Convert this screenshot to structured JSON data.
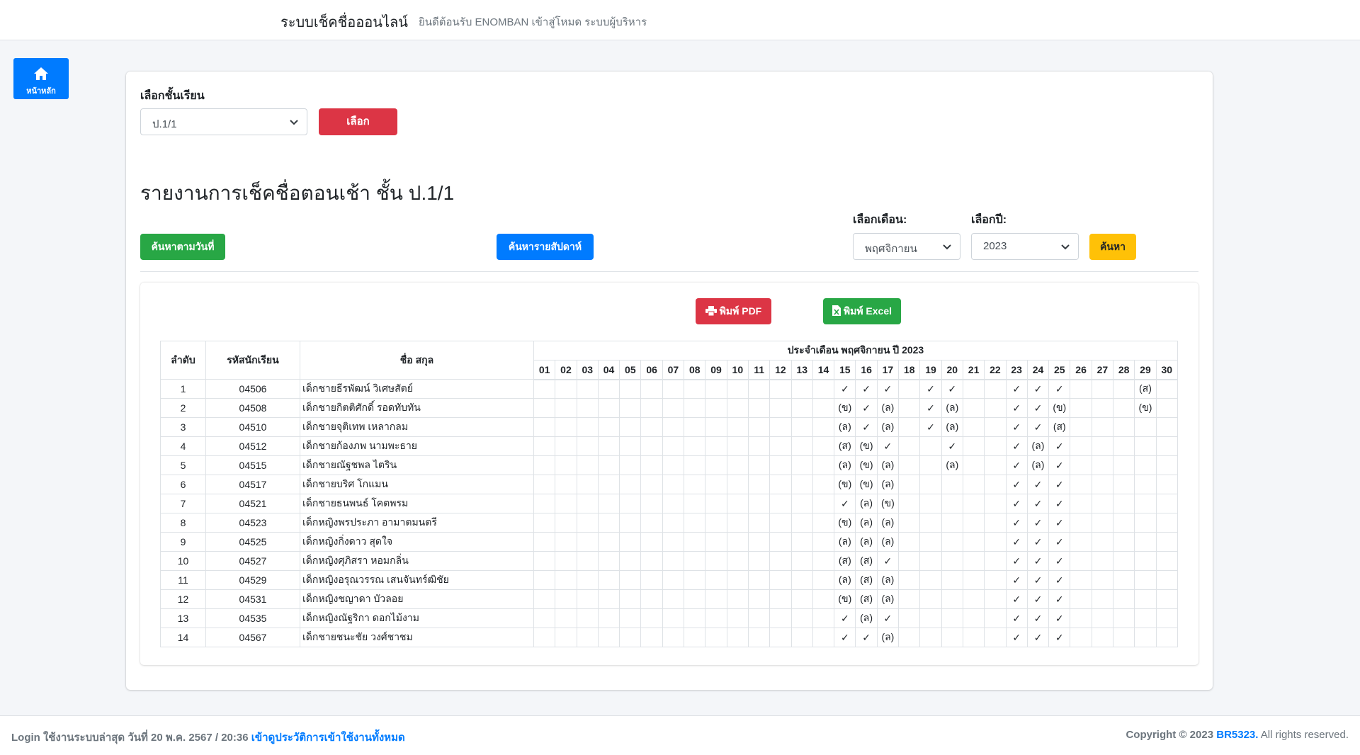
{
  "header": {
    "brand": "ระบบเช็คชื่อออนไลน์",
    "welcome": "ยินดีต้อนรับ ENOMBAN เข้าสู่โหมด ระบบผู้บริหาร"
  },
  "sidebar": {
    "home_label": "หน้าหลัก"
  },
  "class_select": {
    "label": "เลือกชั้นเรียน",
    "value": "ป.1/1",
    "button": "เลือก"
  },
  "report": {
    "title": "รายงานการเช็คชื่อตอนเช้า ชั้น ป.1/1",
    "search_by_date": "ค้นหาตามวันที่",
    "search_by_week": "ค้นหารายสัปดาห์",
    "month_label": "เลือกเดือน:",
    "month_value": "พฤศจิกายน",
    "year_label": "เลือกปี:",
    "year_value": "2023",
    "search_button": "ค้นหา",
    "print_pdf": "พิมพ์ PDF",
    "print_excel": "พิมพ์ Excel"
  },
  "table": {
    "col_no": "ลำดับ",
    "col_id": "รหัสนักเรียน",
    "col_name": "ชื่อ สกุล",
    "month_header": "ประจำเดือน พฤศจิกายน ปี 2023",
    "days": [
      "01",
      "02",
      "03",
      "04",
      "05",
      "06",
      "07",
      "08",
      "09",
      "10",
      "11",
      "12",
      "13",
      "14",
      "15",
      "16",
      "17",
      "18",
      "19",
      "20",
      "21",
      "22",
      "23",
      "24",
      "25",
      "26",
      "27",
      "28",
      "29",
      "30"
    ],
    "rows": [
      {
        "no": "1",
        "id": "04506",
        "name": "เด็กชายธีรพัฒน์ วิเศษสัตย์",
        "marks": {
          "15": "✓",
          "16": "✓",
          "17": "✓",
          "19": "✓",
          "20": "✓",
          "23": "✓",
          "24": "✓",
          "25": "✓",
          "29": "(ส)"
        }
      },
      {
        "no": "2",
        "id": "04508",
        "name": "เด็กชายกิตติศักดิ์ รอดทับทัน",
        "marks": {
          "15": "(ข)",
          "16": "✓",
          "17": "(ล)",
          "19": "✓",
          "20": "(ล)",
          "23": "✓",
          "24": "✓",
          "25": "(ข)",
          "29": "(ข)"
        }
      },
      {
        "no": "3",
        "id": "04510",
        "name": "เด็กชายจุติเทพ เหลากลม",
        "marks": {
          "15": "(ล)",
          "16": "✓",
          "17": "(ล)",
          "19": "✓",
          "20": "(ล)",
          "23": "✓",
          "24": "✓",
          "25": "(ส)"
        }
      },
      {
        "no": "4",
        "id": "04512",
        "name": "เด็กชายก้องภพ นามพะธาย",
        "marks": {
          "15": "(ส)",
          "16": "(ข)",
          "17": "✓",
          "20": "✓",
          "23": "✓",
          "24": "(ล)",
          "25": "✓"
        }
      },
      {
        "no": "5",
        "id": "04515",
        "name": "เด็กชายณัฐชพล ไตริน",
        "marks": {
          "15": "(ล)",
          "16": "(ข)",
          "17": "(ล)",
          "20": "(ล)",
          "23": "✓",
          "24": "(ล)",
          "25": "✓"
        }
      },
      {
        "no": "6",
        "id": "04517",
        "name": "เด็กชายบริศ โกแมน",
        "marks": {
          "15": "(ข)",
          "16": "(ข)",
          "17": "(ล)",
          "23": "✓",
          "24": "✓",
          "25": "✓"
        }
      },
      {
        "no": "7",
        "id": "04521",
        "name": "เด็กชายธนพนธ์ โคตพรม",
        "marks": {
          "15": "✓",
          "16": "(ล)",
          "17": "(ข)",
          "23": "✓",
          "24": "✓",
          "25": "✓"
        }
      },
      {
        "no": "8",
        "id": "04523",
        "name": "เด็กหญิงพรประภา อามาตมนตรี",
        "marks": {
          "15": "(ข)",
          "16": "(ล)",
          "17": "(ล)",
          "23": "✓",
          "24": "✓",
          "25": "✓"
        }
      },
      {
        "no": "9",
        "id": "04525",
        "name": "เด็กหญิงกิ่งดาว สุดใจ",
        "marks": {
          "15": "(ล)",
          "16": "(ล)",
          "17": "(ล)",
          "23": "✓",
          "24": "✓",
          "25": "✓"
        }
      },
      {
        "no": "10",
        "id": "04527",
        "name": "เด็กหญิงศุภิสรา หอมกลิ่น",
        "marks": {
          "15": "(ส)",
          "16": "(ส)",
          "17": "✓",
          "23": "✓",
          "24": "✓",
          "25": "✓"
        }
      },
      {
        "no": "11",
        "id": "04529",
        "name": "เด็กหญิงอรุณวรรณ เสนจันทร์ฒิชัย",
        "marks": {
          "15": "(ล)",
          "16": "(ส)",
          "17": "(ล)",
          "23": "✓",
          "24": "✓",
          "25": "✓"
        }
      },
      {
        "no": "12",
        "id": "04531",
        "name": "เด็กหญิงชญาดา บัวลอย",
        "marks": {
          "15": "(ข)",
          "16": "(ส)",
          "17": "(ล)",
          "23": "✓",
          "24": "✓",
          "25": "✓"
        }
      },
      {
        "no": "13",
        "id": "04535",
        "name": "เด็กหญิงณัฐริกา ดอกไม้งาม",
        "marks": {
          "15": "✓",
          "16": "(ล)",
          "17": "✓",
          "23": "✓",
          "24": "✓",
          "25": "✓"
        }
      },
      {
        "no": "14",
        "id": "04567",
        "name": "เด็กชายชนะชัย วงศ์ชาชม",
        "marks": {
          "15": "✓",
          "16": "✓",
          "17": "(ล)",
          "23": "✓",
          "24": "✓",
          "25": "✓"
        }
      }
    ]
  },
  "footer": {
    "login_text": "Login ใช้งานระบบล่าสุด วันที่ 20 พ.ค. 2567 / 20:36",
    "history_link": "เข้าดูประวัติการเข้าใช้งานทั้งหมด",
    "copyright_prefix": "Copyright © 2023",
    "copyright_brand": "BR5323.",
    "copyright_suffix": "All rights reserved."
  },
  "colors": {
    "primary": "#007bff",
    "success": "#28a745",
    "danger": "#dc3545",
    "warning": "#ffc107"
  }
}
